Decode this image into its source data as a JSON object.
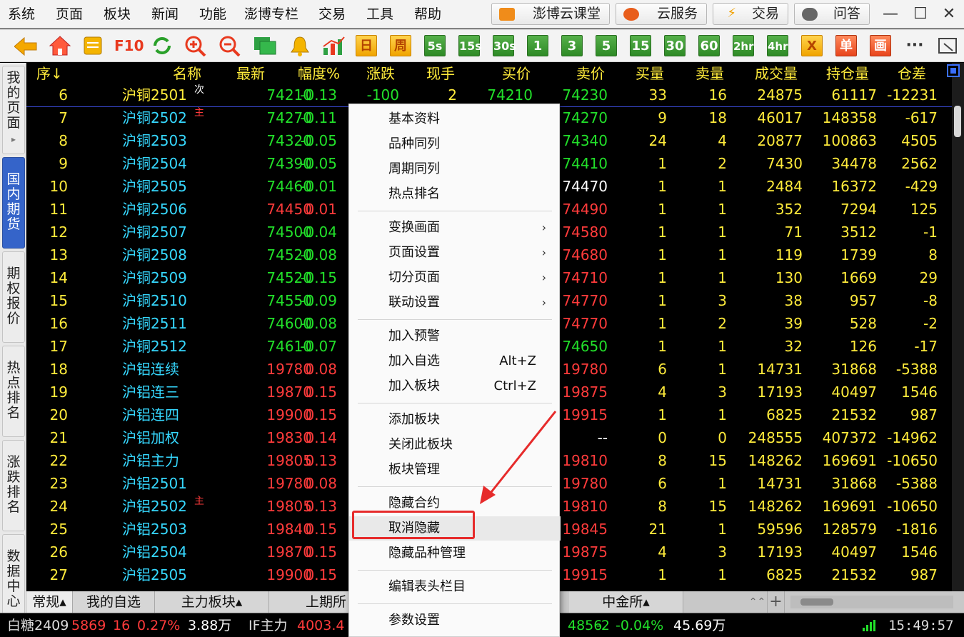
{
  "menubar": {
    "items": [
      "系统",
      "页面",
      "板块",
      "新闻",
      "功能",
      "澎博专栏",
      "交易",
      "工具",
      "帮助"
    ],
    "buttons": [
      "澎博云课堂",
      "云服务",
      "交易",
      "问答"
    ],
    "window_controls": [
      "minimize-icon",
      "maximize-icon",
      "close-icon"
    ]
  },
  "toolbar": {
    "icons": [
      "back-arrow-icon",
      "home-icon",
      "notes-icon",
      "f10-icon",
      "refresh-icon",
      "zoom-in-icon",
      "zoom-out-icon",
      "window-icon",
      "bell-icon",
      "chart-icon"
    ],
    "f10_label": "F10",
    "periods": [
      "日",
      "周",
      "5s",
      "15s",
      "30s",
      "1",
      "3",
      "5",
      "15",
      "30",
      "60",
      "2hr",
      "4hr"
    ],
    "extra": [
      "X",
      "单",
      "画"
    ],
    "more": "···"
  },
  "sidetabs": [
    {
      "label": "我的页面",
      "arrow": "▸"
    },
    {
      "label": "国内期货"
    },
    {
      "label": "期权报价"
    },
    {
      "label": "热点排名"
    },
    {
      "label": "涨跌排名"
    },
    {
      "label": "数据中心"
    }
  ],
  "grid": {
    "headers": [
      "序↓",
      "名称",
      "最新",
      "幅度%",
      "涨跌",
      "现手",
      "买价",
      "卖价",
      "买量",
      "卖量",
      "成交量",
      "持仓量",
      "仓差"
    ],
    "rows": [
      {
        "seq": "6",
        "name": "沪铜2501",
        "tag": "次",
        "last": "74210",
        "pct": "-0.13",
        "chg": "-100",
        "vol": "2",
        "bid": "74210",
        "ask": "74230",
        "bq": "33",
        "aq": "16",
        "turnover": "24875",
        "oi": "61117",
        "oichg": "-12231"
      },
      {
        "seq": "7",
        "name": "沪铜2502",
        "tag": "主",
        "last": "74270",
        "pct": "-0.11",
        "ask": "74270",
        "bq": "9",
        "aq": "18",
        "turnover": "46017",
        "oi": "148358",
        "oichg": "-617"
      },
      {
        "seq": "8",
        "name": "沪铜2503",
        "tag": "",
        "last": "74320",
        "pct": "-0.05",
        "ask": "74340",
        "bq": "24",
        "aq": "4",
        "turnover": "20877",
        "oi": "100863",
        "oichg": "4505"
      },
      {
        "seq": "9",
        "name": "沪铜2504",
        "tag": "",
        "last": "74390",
        "pct": "-0.05",
        "ask": "74410",
        "bq": "1",
        "aq": "2",
        "turnover": "7430",
        "oi": "34478",
        "oichg": "2562"
      },
      {
        "seq": "10",
        "name": "沪铜2505",
        "tag": "",
        "last": "74460",
        "pct": "-0.01",
        "ask": "74470",
        "bq": "1",
        "aq": "1",
        "turnover": "2484",
        "oi": "16372",
        "oichg": "-429"
      },
      {
        "seq": "11",
        "name": "沪铜2506",
        "tag": "",
        "last": "74450",
        "pct": "0.01",
        "ask": "74490",
        "bq": "1",
        "aq": "1",
        "turnover": "352",
        "oi": "7294",
        "oichg": "125"
      },
      {
        "seq": "12",
        "name": "沪铜2507",
        "tag": "",
        "last": "74500",
        "pct": "-0.04",
        "ask": "74580",
        "bq": "1",
        "aq": "1",
        "turnover": "71",
        "oi": "3512",
        "oichg": "-1"
      },
      {
        "seq": "13",
        "name": "沪铜2508",
        "tag": "",
        "last": "74520",
        "pct": "-0.08",
        "ask": "74680",
        "bq": "1",
        "aq": "1",
        "turnover": "119",
        "oi": "1739",
        "oichg": "8"
      },
      {
        "seq": "14",
        "name": "沪铜2509",
        "tag": "",
        "last": "74520",
        "pct": "-0.15",
        "ask": "74710",
        "bq": "1",
        "aq": "1",
        "turnover": "130",
        "oi": "1669",
        "oichg": "29"
      },
      {
        "seq": "15",
        "name": "沪铜2510",
        "tag": "",
        "last": "74550",
        "pct": "-0.09",
        "ask": "74770",
        "bq": "1",
        "aq": "3",
        "turnover": "38",
        "oi": "957",
        "oichg": "-8"
      },
      {
        "seq": "16",
        "name": "沪铜2511",
        "tag": "",
        "last": "74600",
        "pct": "-0.08",
        "ask": "74770",
        "bq": "1",
        "aq": "2",
        "turnover": "39",
        "oi": "528",
        "oichg": "-2"
      },
      {
        "seq": "17",
        "name": "沪铜2512",
        "tag": "",
        "last": "74610",
        "pct": "-0.07",
        "ask": "74650",
        "bq": "1",
        "aq": "1",
        "turnover": "32",
        "oi": "126",
        "oichg": "-17"
      },
      {
        "seq": "18",
        "name": "沪铝连续",
        "tag": "",
        "last": "19780",
        "pct": "0.08",
        "ask": "19780",
        "bq": "6",
        "aq": "1",
        "turnover": "14731",
        "oi": "31868",
        "oichg": "-5388"
      },
      {
        "seq": "19",
        "name": "沪铝连三",
        "tag": "",
        "last": "19870",
        "pct": "0.15",
        "ask": "19875",
        "bq": "4",
        "aq": "3",
        "turnover": "17193",
        "oi": "40497",
        "oichg": "1546"
      },
      {
        "seq": "20",
        "name": "沪铝连四",
        "tag": "",
        "last": "19900",
        "pct": "0.15",
        "ask": "19915",
        "bq": "1",
        "aq": "1",
        "turnover": "6825",
        "oi": "21532",
        "oichg": "987"
      },
      {
        "seq": "21",
        "name": "沪铝加权",
        "tag": "",
        "last": "19830",
        "pct": "0.14",
        "ask": "--",
        "bq": "0",
        "aq": "0",
        "turnover": "248555",
        "oi": "407372",
        "oichg": "-14962"
      },
      {
        "seq": "22",
        "name": "沪铝主力",
        "tag": "",
        "last": "19805",
        "pct": "0.13",
        "ask": "19810",
        "bq": "8",
        "aq": "15",
        "turnover": "148262",
        "oi": "169691",
        "oichg": "-10650"
      },
      {
        "seq": "23",
        "name": "沪铝2501",
        "tag": "",
        "last": "19780",
        "pct": "0.08",
        "ask": "19780",
        "bq": "6",
        "aq": "1",
        "turnover": "14731",
        "oi": "31868",
        "oichg": "-5388"
      },
      {
        "seq": "24",
        "name": "沪铝2502",
        "tag": "主",
        "last": "19805",
        "pct": "0.13",
        "ask": "19810",
        "bq": "8",
        "aq": "15",
        "turnover": "148262",
        "oi": "169691",
        "oichg": "-10650"
      },
      {
        "seq": "25",
        "name": "沪铝2503",
        "tag": "",
        "last": "19840",
        "pct": "0.15",
        "ask": "19845",
        "bq": "21",
        "aq": "1",
        "turnover": "59596",
        "oi": "128579",
        "oichg": "-1816"
      },
      {
        "seq": "26",
        "name": "沪铝2504",
        "tag": "",
        "last": "19870",
        "pct": "0.15",
        "ask": "19875",
        "bq": "4",
        "aq": "3",
        "turnover": "17193",
        "oi": "40497",
        "oichg": "1546"
      },
      {
        "seq": "27",
        "name": "沪铝2505",
        "tag": "",
        "last": "19900",
        "pct": "0.15",
        "ask": "19915",
        "bq": "1",
        "aq": "1",
        "turnover": "6825",
        "oi": "21532",
        "oichg": "987"
      }
    ]
  },
  "bottomtabs": [
    "常规▴",
    "我的自选",
    "主力板块▴",
    "上期所",
    "中金所▴"
  ],
  "bottom_controls": [
    "⌃⌃",
    "+"
  ],
  "statusbar": {
    "q1_name": "白糖2409",
    "q1_last": "5869",
    "q1_chg": "16",
    "q1_pct": "0.27%",
    "q1_amt": "3.88万",
    "q2_name": "IF主力",
    "q2_last": "4003.4",
    "q3_last": "4856",
    "q3_chg": "-2",
    "q3_pct": "-0.04%",
    "q3_amt": "45.69万",
    "time": "15:49:57"
  },
  "context_menu": {
    "groups": [
      [
        {
          "label": "基本资料"
        },
        {
          "label": "品种同列"
        },
        {
          "label": "周期同列"
        },
        {
          "label": "热点排名"
        }
      ],
      [
        {
          "label": "变换画面",
          "submenu": true
        },
        {
          "label": "页面设置",
          "submenu": true
        },
        {
          "label": "切分页面",
          "submenu": true
        },
        {
          "label": "联动设置",
          "submenu": true
        }
      ],
      [
        {
          "label": "加入预警"
        },
        {
          "label": "加入自选",
          "shortcut": "Alt+Z"
        },
        {
          "label": "加入板块",
          "shortcut": "Ctrl+Z"
        }
      ],
      [
        {
          "label": "添加板块"
        },
        {
          "label": "关闭此板块"
        },
        {
          "label": "板块管理"
        }
      ],
      [
        {
          "label": "隐藏合约"
        },
        {
          "label": "取消隐藏",
          "highlighted": true
        },
        {
          "label": "隐藏品种管理"
        }
      ],
      [
        {
          "label": "编辑表头栏目"
        }
      ],
      [
        {
          "label": "参数设置"
        }
      ]
    ]
  },
  "colors": {
    "up": "#ff3b3b",
    "down": "#22e02a",
    "name": "#36d8ff",
    "header": "#ffeb3b",
    "annotation": "#e62b2b",
    "active_tab": "#3564c9"
  }
}
